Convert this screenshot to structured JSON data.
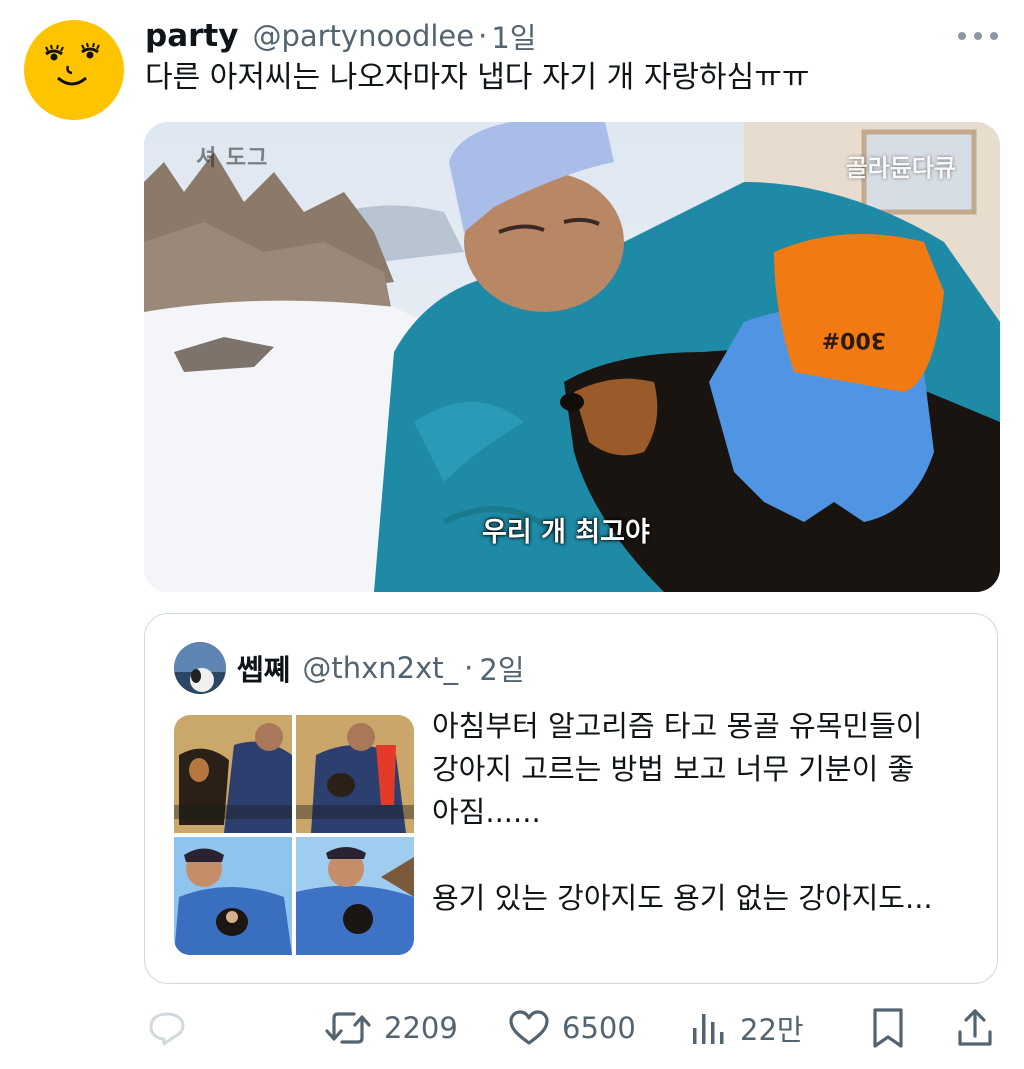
{
  "tweet": {
    "display_name": "party",
    "handle": "@partynoodlee",
    "separator": "·",
    "time": "1일",
    "text": "다른 아저씨는 나오자마자 냅다 자기 개  자랑하심ㅠㅠ"
  },
  "media": {
    "watermark_left": "셔 도그",
    "watermark_right": "골라듄다큐",
    "caption": "우리 개 최고야",
    "glove_text": "300#"
  },
  "quote": {
    "display_name": "쎕쪠",
    "handle": "@thxn2xt_",
    "separator": "·",
    "time": "2일",
    "lines": [
      "아침부터 알고리즘 타고 몽골 유목민들이",
      "강아지 고르는 방법 보고 너무 기분이 좋",
      "아짐......",
      "",
      "용기 있는 강아지도 용기 없는 강아지도..."
    ]
  },
  "actions": {
    "retweets": "2209",
    "likes": "6500",
    "views": "22만"
  },
  "icons": {
    "reply": "reply-icon",
    "retweet": "retweet-icon",
    "like": "heart-icon",
    "views": "views-icon",
    "bookmark": "bookmark-icon",
    "share": "share-icon"
  }
}
